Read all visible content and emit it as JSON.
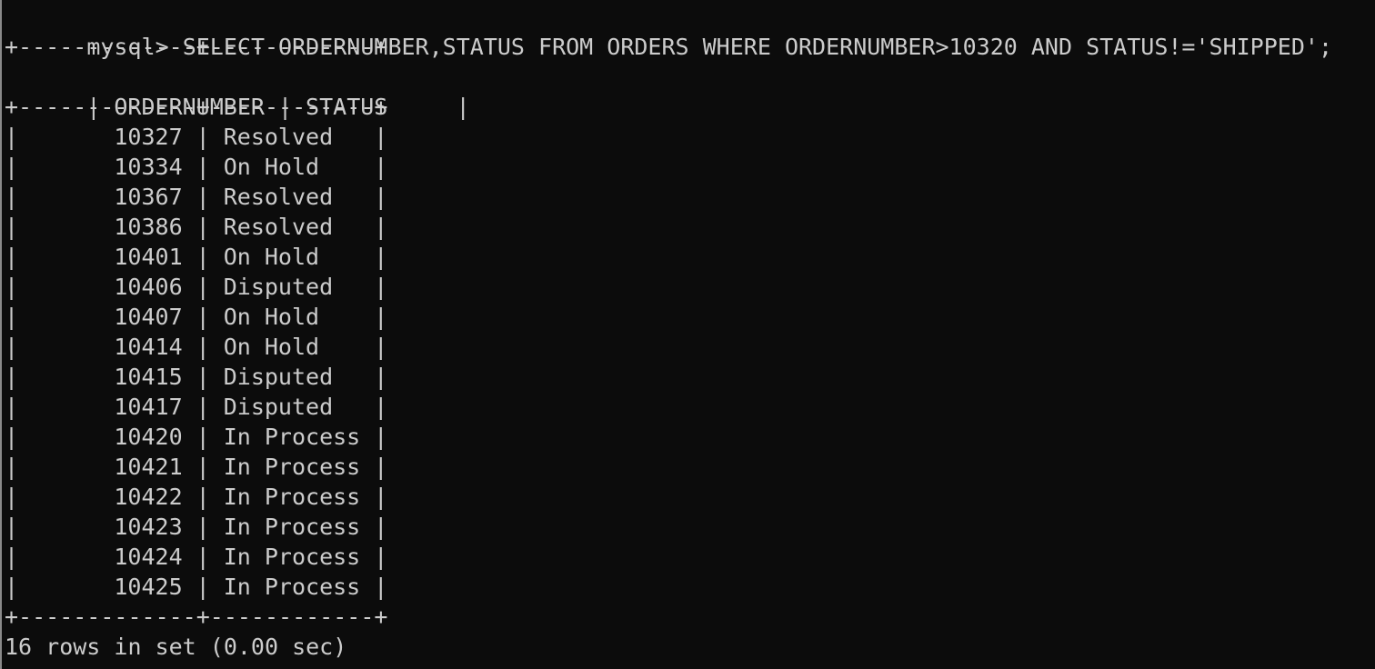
{
  "prompt": "mysql>",
  "command": "SELECT ORDERNUMBER,STATUS FROM ORDERS WHERE ORDERNUMBER>10320 AND STATUS!='SHIPPED';",
  "table": {
    "border": "+-------------+------------+",
    "columns": [
      "ORDERNUMBER",
      "STATUS"
    ],
    "rows": [
      [
        "10327",
        "Resolved"
      ],
      [
        "10334",
        "On Hold"
      ],
      [
        "10367",
        "Resolved"
      ],
      [
        "10386",
        "Resolved"
      ],
      [
        "10401",
        "On Hold"
      ],
      [
        "10406",
        "Disputed"
      ],
      [
        "10407",
        "On Hold"
      ],
      [
        "10414",
        "On Hold"
      ],
      [
        "10415",
        "Disputed"
      ],
      [
        "10417",
        "Disputed"
      ],
      [
        "10420",
        "In Process"
      ],
      [
        "10421",
        "In Process"
      ],
      [
        "10422",
        "In Process"
      ],
      [
        "10423",
        "In Process"
      ],
      [
        "10424",
        "In Process"
      ],
      [
        "10425",
        "In Process"
      ]
    ]
  },
  "result_summary": "16 rows in set (0.00 sec)",
  "colors": {
    "background": "#0c0c0c",
    "text": "#cccccc"
  }
}
